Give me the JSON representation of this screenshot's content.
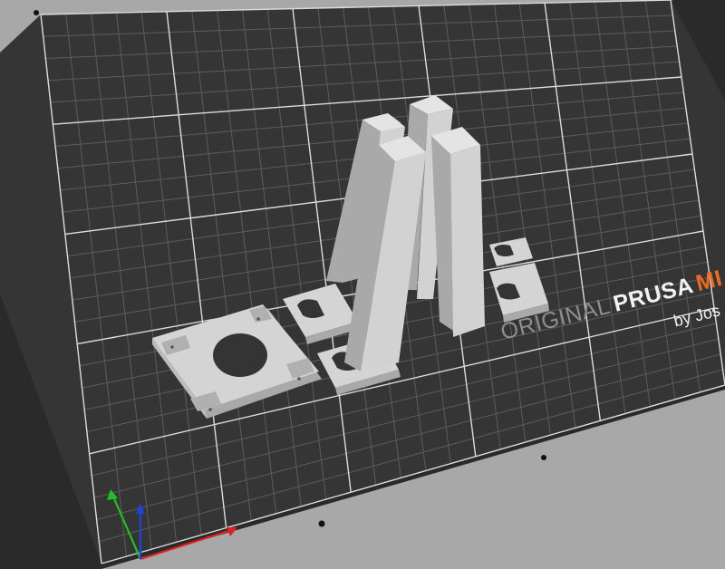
{
  "bed_logo": {
    "word_original": "ORIGINAL",
    "word_prusa": "PRUSA",
    "word_model": "MI",
    "byline": "by Jos"
  },
  "colors": {
    "background": "#a8a8a8",
    "bed_surface": "#343434",
    "bed_edge": "#262626",
    "grid_line": "#5a5a5a",
    "grid_major": "#e8e8e8",
    "model": "#d2d2d2",
    "model_shade": "#a9a9a9",
    "logo_gray": "#8e8e8e",
    "logo_white": "#f2f2f2",
    "logo_orange": "#ed6b21",
    "axis_x": "#e02020",
    "axis_y": "#20c020",
    "axis_z": "#2040e0"
  },
  "icons": [
    "axis-gizmo-icon"
  ]
}
